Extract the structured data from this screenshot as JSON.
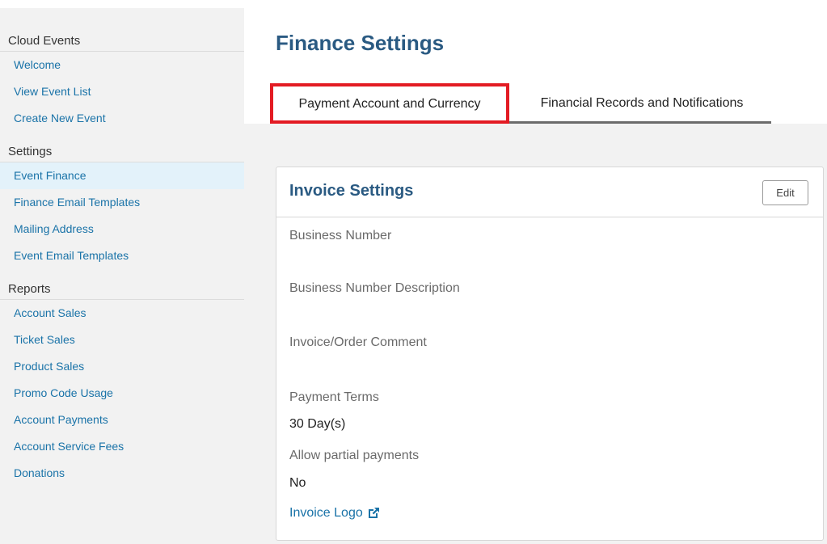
{
  "sidebar": {
    "sections": [
      {
        "title": "Cloud Events",
        "items": [
          {
            "label": "Welcome"
          },
          {
            "label": "View Event List"
          },
          {
            "label": "Create New Event"
          }
        ]
      },
      {
        "title": "Settings",
        "items": [
          {
            "label": "Event Finance",
            "active": true
          },
          {
            "label": "Finance Email Templates"
          },
          {
            "label": "Mailing Address"
          },
          {
            "label": "Event Email Templates"
          }
        ]
      },
      {
        "title": "Reports",
        "items": [
          {
            "label": "Account Sales"
          },
          {
            "label": "Ticket Sales"
          },
          {
            "label": "Product Sales"
          },
          {
            "label": "Promo Code Usage"
          },
          {
            "label": "Account Payments"
          },
          {
            "label": "Account Service Fees"
          },
          {
            "label": "Donations"
          }
        ]
      }
    ]
  },
  "main": {
    "title": "Finance Settings",
    "tabs": [
      {
        "label": "Payment Account and Currency",
        "highlighted": true
      },
      {
        "label": "Financial Records and Notifications"
      }
    ],
    "card": {
      "title": "Invoice Settings",
      "edit_label": "Edit",
      "fields": [
        {
          "label": "Business Number",
          "value": ""
        },
        {
          "label": "Business Number Description",
          "value": ""
        },
        {
          "label": "Invoice/Order Comment",
          "value": ""
        },
        {
          "label": "Payment Terms",
          "value": "30 Day(s)"
        },
        {
          "label": "Allow partial payments",
          "value": "No"
        }
      ],
      "logo_link": "Invoice Logo",
      "logo_icon": "external-link-icon"
    }
  },
  "colors": {
    "accent": "#2a5a82",
    "link": "#1a73a8",
    "highlight_border": "#e31b23",
    "active_item_bg": "#e3f2fa"
  }
}
